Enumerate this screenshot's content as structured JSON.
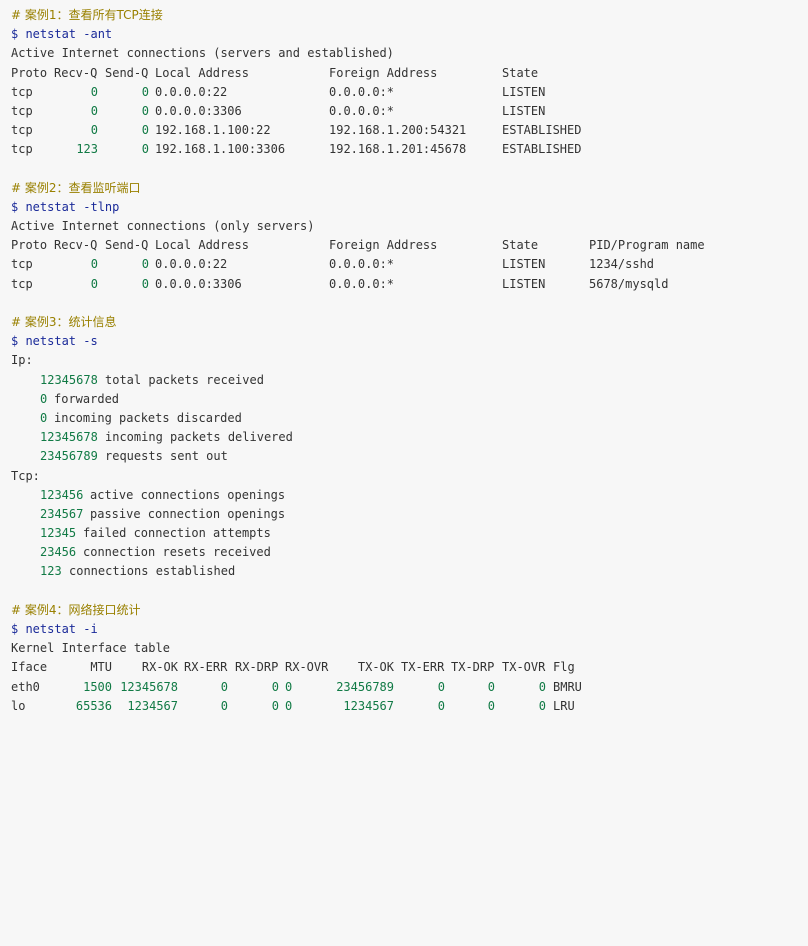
{
  "ex1": {
    "comment": "# 案例1：查看所有TCP连接",
    "cmd": "$ netstat -ant",
    "title": "Active Internet connections (servers and established)",
    "headers": [
      "Proto",
      "Recv-Q",
      "Send-Q",
      "Local Address",
      "Foreign Address",
      "State"
    ],
    "rows": [
      [
        "tcp",
        "0",
        "0",
        "0.0.0.0:22",
        "0.0.0.0:*",
        "LISTEN"
      ],
      [
        "tcp",
        "0",
        "0",
        "0.0.0.0:3306",
        "0.0.0.0:*",
        "LISTEN"
      ],
      [
        "tcp",
        "0",
        "0",
        "192.168.1.100:22",
        "192.168.1.200:54321",
        "ESTABLISHED"
      ],
      [
        "tcp",
        "123",
        "0",
        "192.168.1.100:3306",
        "192.168.1.201:45678",
        "ESTABLISHED"
      ]
    ]
  },
  "ex2": {
    "comment": "# 案例2：查看监听端口",
    "cmd": "$ netstat -tlnp",
    "title": "Active Internet connections (only servers)",
    "headers": [
      "Proto",
      "Recv-Q",
      "Send-Q",
      "Local Address",
      "Foreign Address",
      "State",
      "PID/Program name"
    ],
    "rows": [
      [
        "tcp",
        "0",
        "0",
        "0.0.0.0:22",
        "0.0.0.0:*",
        "LISTEN",
        "1234/sshd"
      ],
      [
        "tcp",
        "0",
        "0",
        "0.0.0.0:3306",
        "0.0.0.0:*",
        "LISTEN",
        "5678/mysqld"
      ]
    ]
  },
  "ex3": {
    "comment": "# 案例3：统计信息",
    "cmd": "$ netstat -s",
    "ip_label": "Ip:",
    "ip_stats": [
      {
        "num": "12345678",
        "text": "total packets received"
      },
      {
        "num": "0",
        "text": "forwarded"
      },
      {
        "num": "0",
        "text": "incoming packets discarded"
      },
      {
        "num": "12345678",
        "text": "incoming packets delivered"
      },
      {
        "num": "23456789",
        "text": "requests sent out"
      }
    ],
    "tcp_label": "Tcp:",
    "tcp_stats": [
      {
        "num": "123456",
        "text": "active connections openings"
      },
      {
        "num": "234567",
        "text": "passive connection openings"
      },
      {
        "num": "12345",
        "text": "failed connection attempts"
      },
      {
        "num": "23456",
        "text": "connection resets received"
      },
      {
        "num": "123",
        "text": "connections established"
      }
    ]
  },
  "ex4": {
    "comment": "# 案例4：网络接口统计",
    "cmd": "$ netstat -i",
    "title": "Kernel Interface table",
    "headers": [
      "Iface",
      "MTU",
      "RX-OK",
      "RX-ERR",
      "RX-DRP",
      "RX-OVR",
      "TX-OK",
      "TX-ERR",
      "TX-DRP",
      "TX-OVR",
      "Flg"
    ],
    "rows": [
      [
        "eth0",
        "1500",
        "12345678",
        "0",
        "0",
        "0",
        "23456789",
        "0",
        "0",
        "0",
        "BMRU"
      ],
      [
        "lo",
        "65536",
        "1234567",
        "0",
        "0",
        "0",
        "1234567",
        "0",
        "0",
        "0",
        "LRU"
      ]
    ]
  }
}
